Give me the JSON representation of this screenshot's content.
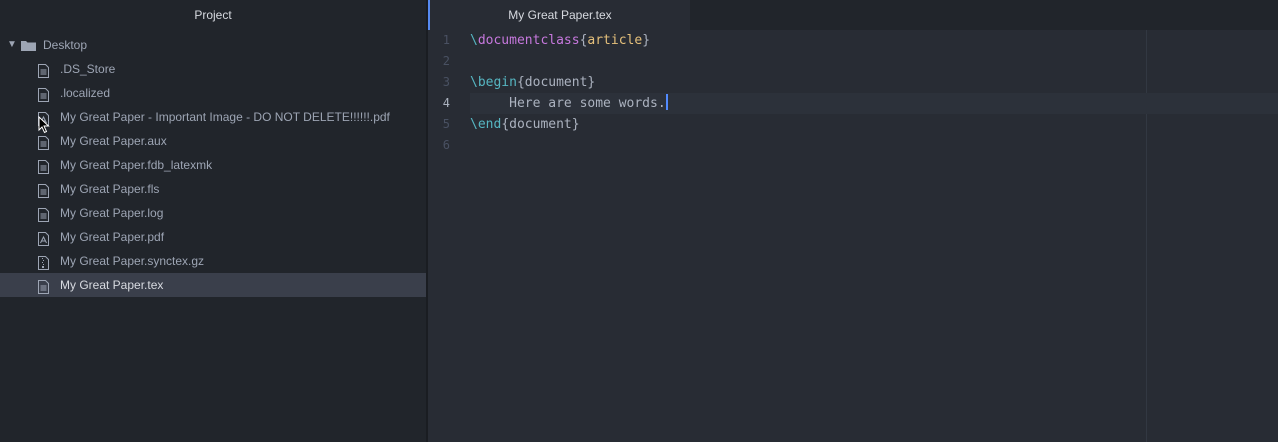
{
  "sidebar": {
    "title": "Project",
    "root": {
      "label": "Desktop",
      "icon": "folder-icon",
      "expanded": true
    },
    "files": [
      {
        "label": ".DS_Store",
        "icon": "file-text-icon"
      },
      {
        "label": ".localized",
        "icon": "file-text-icon"
      },
      {
        "label": "My Great Paper - Important Image - DO NOT DELETE!!!!!!.pdf",
        "icon": "file-pdf-icon"
      },
      {
        "label": "My Great Paper.aux",
        "icon": "file-text-icon"
      },
      {
        "label": "My Great Paper.fdb_latexmk",
        "icon": "file-text-icon"
      },
      {
        "label": "My Great Paper.fls",
        "icon": "file-text-icon"
      },
      {
        "label": "My Great Paper.log",
        "icon": "file-text-icon"
      },
      {
        "label": "My Great Paper.pdf",
        "icon": "file-pdf-icon"
      },
      {
        "label": "My Great Paper.synctex.gz",
        "icon": "file-zip-icon"
      },
      {
        "label": "My Great Paper.tex",
        "icon": "file-text-icon",
        "selected": true
      }
    ]
  },
  "tabs": [
    {
      "label": "My Great Paper.tex",
      "active": true
    }
  ],
  "editor": {
    "line_numbers": [
      "1",
      "2",
      "3",
      "4",
      "5",
      "6"
    ],
    "current_line": 4,
    "lines": [
      {
        "tokens": [
          [
            "\\",
            "kw"
          ],
          [
            "documentclass",
            "cmd"
          ],
          [
            "{",
            "plain"
          ],
          [
            "article",
            "arg"
          ],
          [
            "}",
            "plain"
          ]
        ]
      },
      {
        "tokens": []
      },
      {
        "tokens": [
          [
            "\\begin",
            "kw"
          ],
          [
            "{document}",
            "plain"
          ]
        ]
      },
      {
        "tokens": [
          [
            "     Here are some words.",
            "plain"
          ]
        ],
        "caret": true
      },
      {
        "tokens": [
          [
            "\\end",
            "kw"
          ],
          [
            "{document}",
            "plain"
          ]
        ]
      },
      {
        "tokens": []
      }
    ]
  },
  "colors": {
    "sidebar_bg": "#21252b",
    "editor_bg": "#282c34",
    "selection_bg": "#3a3f4b",
    "accent": "#568af2"
  }
}
